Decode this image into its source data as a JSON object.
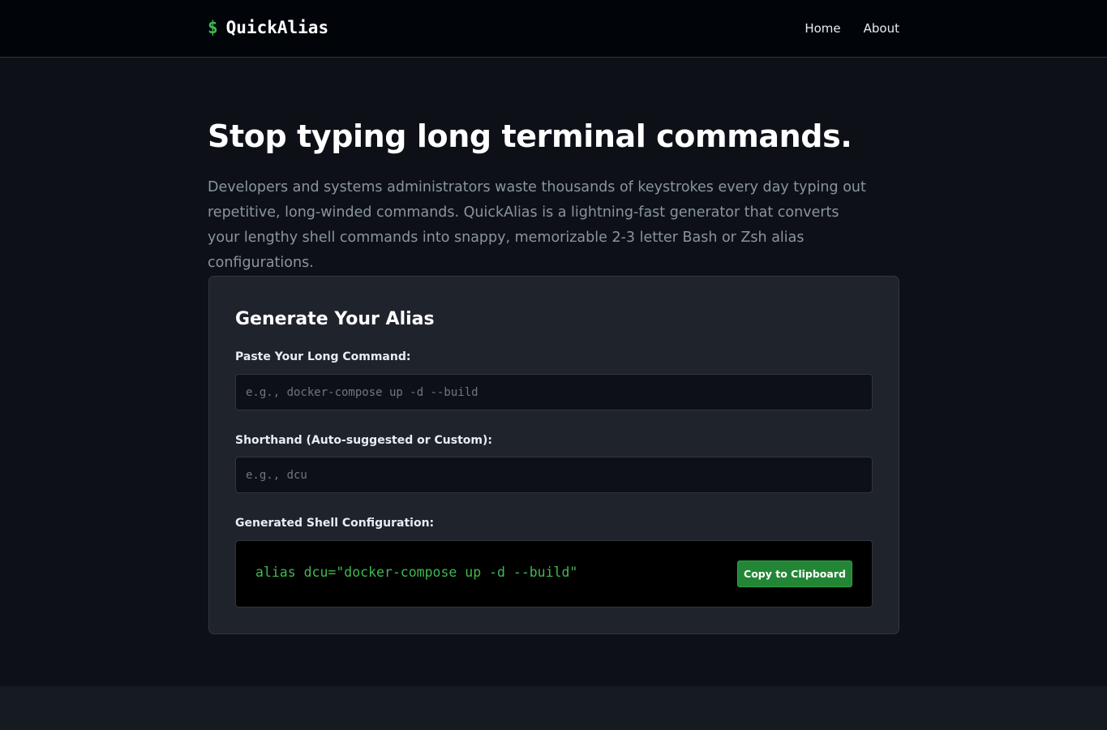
{
  "nav": {
    "brand_symbol": "$",
    "brand_name": "QuickAlias",
    "links": [
      {
        "label": "Home"
      },
      {
        "label": "About"
      }
    ]
  },
  "hero": {
    "title": "Stop typing long terminal commands.",
    "description": "Developers and systems administrators waste thousands of keystrokes every day typing out repetitive, long-winded commands. QuickAlias is a lightning-fast generator that converts your lengthy shell commands into snappy, memorizable 2-3 letter Bash or Zsh alias configurations."
  },
  "generator": {
    "title": "Generate Your Alias",
    "command_label": "Paste Your Long Command:",
    "command_placeholder": "e.g., docker-compose up -d --build",
    "command_value": "",
    "shorthand_label": "Shorthand (Auto-suggested or Custom):",
    "shorthand_placeholder": "e.g., dcu",
    "shorthand_value": "",
    "output_label": "Generated Shell Configuration:",
    "output_code": "alias dcu=\"docker-compose up -d --build\"",
    "copy_button": "Copy to Clipboard"
  },
  "colors": {
    "background": "#0d1117",
    "navbar": "#010409",
    "card": "#1f242c",
    "accent_green": "#3fb950",
    "button_green": "#238636",
    "muted_text": "#8b949e"
  }
}
